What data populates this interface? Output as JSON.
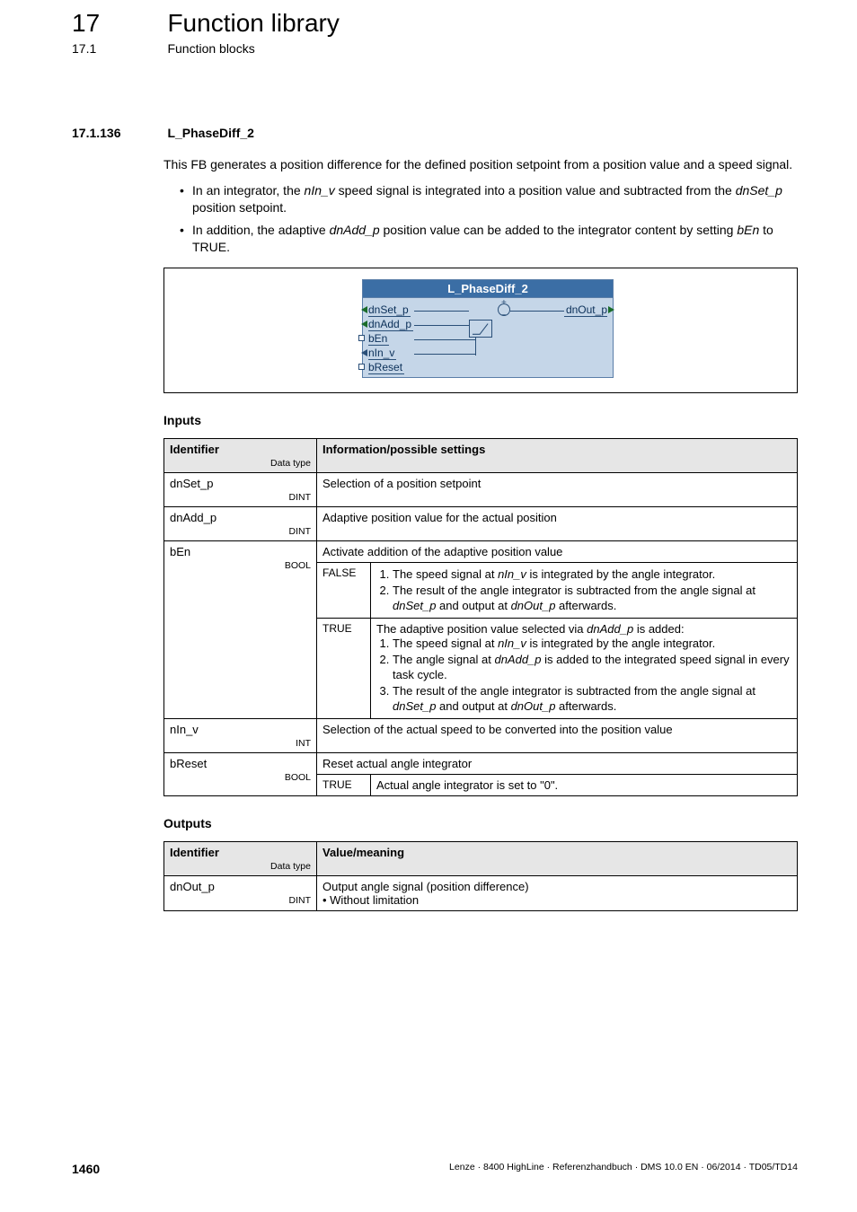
{
  "chapter": {
    "num": "17",
    "title": "Function library"
  },
  "sub": {
    "num": "17.1",
    "title": "Function blocks"
  },
  "dashes": "_ _ _ _ _ _ _ _ _ _ _ _ _ _ _ _ _ _ _ _ _ _ _ _ _ _ _ _ _ _ _ _ _ _ _ _ _ _ _ _ _ _ _ _ _ _ _ _ _ _ _ _ _ _ _ _ _ _ _ _ _ _ _ _",
  "section": {
    "num": "17.1.136",
    "title": "L_PhaseDiff_2"
  },
  "intro": "This FB generates a position difference for the defined position setpoint from a position value and a speed signal.",
  "bullets": [
    {
      "pre": "In an integrator, the ",
      "i1": "nIn_v",
      "mid": " speed signal is integrated into a position value and subtracted from the ",
      "i2": "dnSet_p",
      "post": " position setpoint."
    },
    {
      "pre": "In addition, the adaptive ",
      "i1": "dnAdd_p",
      "mid": " position value can be added to the integrator content by setting ",
      "i2": "bEn",
      "post": " to TRUE."
    }
  ],
  "diagram": {
    "title": "L_PhaseDiff_2",
    "ports_left": [
      "dnSet_p",
      "dnAdd_p",
      "bEn",
      "nIn_v",
      "bReset"
    ],
    "port_right": "dnOut_p"
  },
  "inputs": {
    "heading": "Inputs",
    "col1": "Identifier",
    "col1_sub": "Data type",
    "col2": "Information/possible settings",
    "rows": [
      {
        "id": "dnSet_p",
        "dt": "DINT",
        "info": "Selection of a position setpoint"
      },
      {
        "id": "dnAdd_p",
        "dt": "DINT",
        "info": "Adaptive position value for the actual position"
      },
      {
        "id": "bEn",
        "dt": "BOOL",
        "info": "Activate addition of the adaptive position value",
        "sub": [
          {
            "label": "FALSE",
            "lines": {
              "l1a": "The speed signal at ",
              "l1i": "nIn_v",
              "l1b": " is integrated by the angle integrator.",
              "l2a": "The result of the angle integrator is subtracted from the angle signal at ",
              "l2i": "dnSet_p",
              "l2b": " and output at ",
              "l2i2": "dnOut_p",
              "l2c": " afterwards."
            }
          },
          {
            "label": "TRUE",
            "lead_a": "The adaptive position value selected via ",
            "lead_i": "dnAdd_p",
            "lead_b": " is added:",
            "lines": {
              "l1a": "The speed signal at ",
              "l1i": "nIn_v",
              "l1b": " is integrated by the angle integrator.",
              "l2a": "The angle signal at ",
              "l2i": "dnAdd_p",
              "l2b": " is added to the integrated speed signal in every task cycle.",
              "l3a": "The result of the angle integrator is subtracted from the angle signal at ",
              "l3i": "dnSet_p",
              "l3b": " and output at ",
              "l3i2": "dnOut_p",
              "l3c": " afterwards."
            }
          }
        ]
      },
      {
        "id": "nIn_v",
        "dt": "INT",
        "info": "Selection of the actual speed to be converted into the position value"
      },
      {
        "id": "bReset",
        "dt": "BOOL",
        "info": "Reset actual angle integrator",
        "sub": [
          {
            "label": "TRUE",
            "plain": "Actual angle integrator is set to \"0\"."
          }
        ]
      }
    ]
  },
  "outputs": {
    "heading": "Outputs",
    "col1": "Identifier",
    "col1_sub": "Data type",
    "col2": "Value/meaning",
    "rows": [
      {
        "id": "dnOut_p",
        "dt": "DINT",
        "l1": "Output angle signal (position difference)",
        "l2": "• Without limitation"
      }
    ]
  },
  "footer": {
    "page": "1460",
    "text": "Lenze · 8400 HighLine · Referenzhandbuch · DMS 10.0 EN · 06/2014 · TD05/TD14"
  }
}
